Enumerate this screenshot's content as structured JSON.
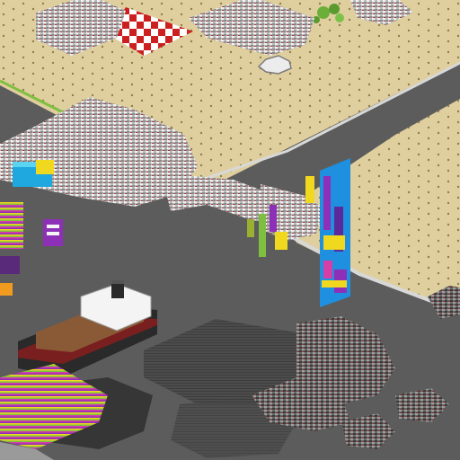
{
  "scene": {
    "kind": "isometric-city-builder-view",
    "palette": {
      "sand": "#dfcf9e",
      "sand_dot": "#7a6a3a",
      "grass_edge": "#7fbf3f",
      "asphalt": "#5c5c5c",
      "curb": "#d8d8d8",
      "track_light": "#cfcfcf",
      "track_red": "#a43a3a",
      "shadow": "#2f2f2f",
      "ship_hull": "#2a2a2a",
      "ship_stripe": "#7a1f1f",
      "ship_deck": "#8a5a36",
      "ship_cabin": "#f4f4f4",
      "checker_red": "#cc1f1f",
      "checker_white": "#ffffff",
      "tower_blue": "#1f8fdf",
      "tower_purple": "#8e2fb8",
      "tower_yellow": "#f0d81f",
      "tower_pink": "#d63fa8",
      "foliage": "#6cae3a"
    },
    "objects": [
      "checkered-plaza",
      "rollercoaster-track-cluster",
      "cargo-ship",
      "striped-billboard-tower",
      "multicolor-stall-row",
      "octagon-fountain",
      "tree-clump"
    ]
  }
}
